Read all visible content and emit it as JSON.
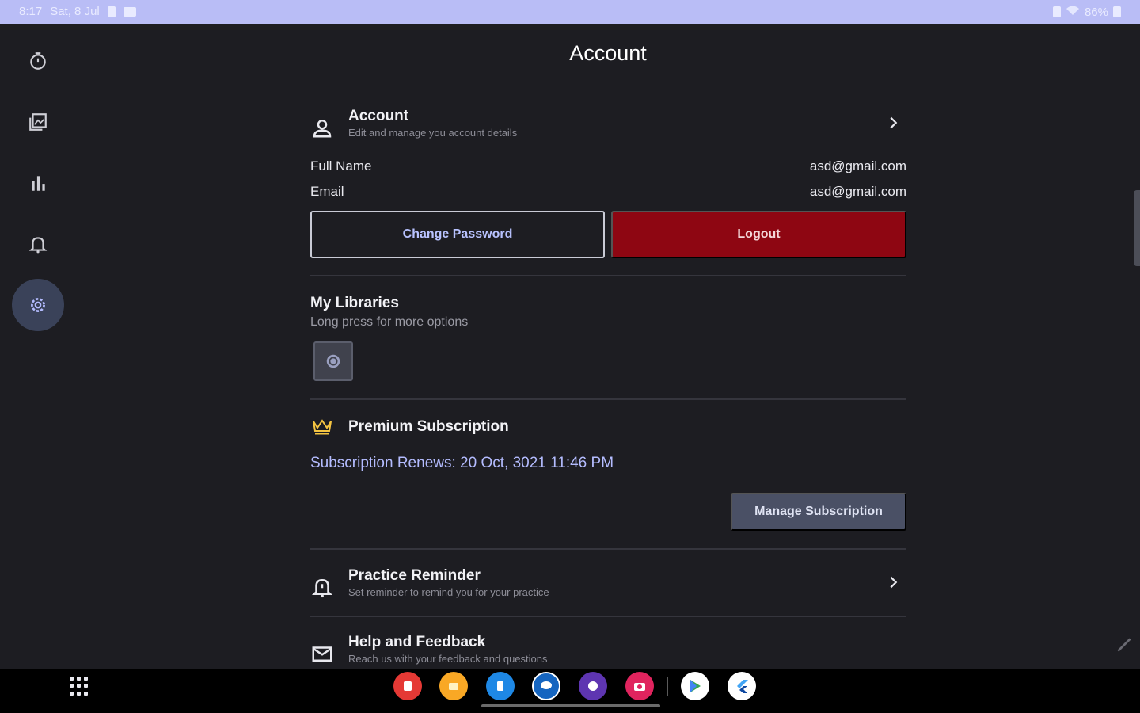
{
  "status_bar": {
    "time": "8:17",
    "date": "Sat, 8 Jul",
    "battery": "86%"
  },
  "nav_rail": {
    "items": [
      {
        "icon": "timer-icon",
        "active": false
      },
      {
        "icon": "library-icon",
        "active": false
      },
      {
        "icon": "stats-icon",
        "active": false
      },
      {
        "icon": "bell-icon",
        "active": false
      },
      {
        "icon": "settings-icon",
        "active": true
      }
    ]
  },
  "header": {
    "title": "Account"
  },
  "account_section": {
    "title": "Account",
    "subtitle": "Edit and manage you account details",
    "icon": "person-icon"
  },
  "details": [
    {
      "key": "Full Name",
      "value": "asd@gmail.com"
    },
    {
      "key": "Email",
      "value": "asd@gmail.com"
    }
  ],
  "buttons": {
    "change_password": "Change Password",
    "logout": "Logout",
    "manage_subscription": "Manage Subscription"
  },
  "libraries": {
    "title": "My Libraries",
    "subtitle": "Long press for more options"
  },
  "premium": {
    "title": "Premium Subscription",
    "icon": "crown-icon",
    "renews": "Subscription Renews: 20 Oct, 3021 11:46 PM"
  },
  "practice_reminder": {
    "title": "Practice Reminder",
    "subtitle": "Set reminder to remind you for your practice",
    "icon": "alarm-icon"
  },
  "help": {
    "title": "Help and Feedback",
    "subtitle": "Reach us with your feedback and questions",
    "icon": "mail-icon"
  },
  "dock": {
    "apps": [
      {
        "name": "app-red",
        "color": "#e53935"
      },
      {
        "name": "files",
        "color": "#f9a825"
      },
      {
        "name": "app-blue",
        "color": "#1e88e5"
      },
      {
        "name": "messages",
        "color": "#1565c0"
      },
      {
        "name": "app-purple",
        "color": "#5e35b1"
      },
      {
        "name": "camera",
        "color": "#e0245e"
      },
      {
        "name": "play-store",
        "color": "#ffffff"
      },
      {
        "name": "flutter",
        "color": "#ffffff"
      }
    ]
  },
  "colors": {
    "accent": "#b4bcff",
    "danger": "#8e0612",
    "background": "#1d1d22",
    "crown": "#f5c542"
  }
}
